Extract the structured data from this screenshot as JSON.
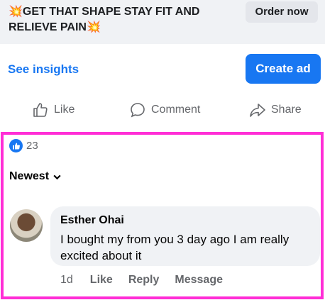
{
  "ad": {
    "headline_burst_left": "💥",
    "headline_line1": "GET THAT SHAPE STAY FIT AND",
    "headline_line2": "RELIEVE PAIN",
    "headline_burst_right": "💥",
    "order_now_label": "Order now"
  },
  "insights": {
    "see_insights_label": "See insights",
    "create_ad_label": "Create ad"
  },
  "actions": {
    "like_label": "Like",
    "comment_label": "Comment",
    "share_label": "Share"
  },
  "reactions": {
    "count": "23"
  },
  "sort": {
    "label": "Newest"
  },
  "comment": {
    "author": "Esther Ohai",
    "text": "I bought my from you 3 day ago  I am really excited about it",
    "time": "1d",
    "like_label": "Like",
    "reply_label": "Reply",
    "message_label": "Message"
  },
  "colors": {
    "accent": "#1877f2",
    "highlight_border": "#ff2ed6"
  }
}
